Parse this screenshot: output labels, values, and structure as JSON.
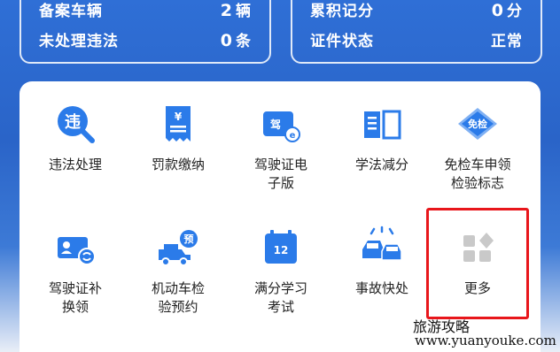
{
  "stats_left": {
    "rows": [
      {
        "label": "备案车辆",
        "num": "2",
        "unit": "辆"
      },
      {
        "label": "未处理违法",
        "num": "0",
        "unit": "条"
      }
    ]
  },
  "stats_right": {
    "rows": [
      {
        "label": "累积记分",
        "num": "0",
        "unit": "分"
      },
      {
        "label": "证件状态",
        "num": "",
        "unit": "正常"
      }
    ]
  },
  "services": [
    {
      "line1": "违法处理",
      "line2": "",
      "icon": "violation-search-icon"
    },
    {
      "line1": "罚款缴纳",
      "line2": "",
      "icon": "fine-payment-receipt-icon"
    },
    {
      "line1": "驾驶证电",
      "line2": "子版",
      "icon": "electronic-license-icon"
    },
    {
      "line1": "学法减分",
      "line2": "",
      "icon": "study-book-icon"
    },
    {
      "line1": "免检车申领",
      "line2": "检验标志",
      "icon": "inspection-exempt-badge-icon"
    },
    {
      "line1": "驾驶证补",
      "line2": "换领",
      "icon": "license-renewal-icon"
    },
    {
      "line1": "机动车检",
      "line2": "验预约",
      "icon": "vehicle-inspection-booking-icon"
    },
    {
      "line1": "满分学习",
      "line2": "考试",
      "icon": "calendar-exam-icon"
    },
    {
      "line1": "事故快处",
      "line2": "",
      "icon": "accident-cars-icon"
    },
    {
      "line1": "更多",
      "line2": "",
      "icon": "more-grid-icon"
    }
  ],
  "icon_badges": {
    "violation": "违",
    "license": "驾",
    "inspection": "免检",
    "booking": "预",
    "calendar": "12"
  },
  "colors": {
    "primary_blue": "#2b7be9",
    "highlight_red": "#e8161b",
    "more_gray": "#c9c9c9"
  },
  "watermark": {
    "line1": "旅游攻略",
    "line2": "www.yuanyouke.com"
  }
}
